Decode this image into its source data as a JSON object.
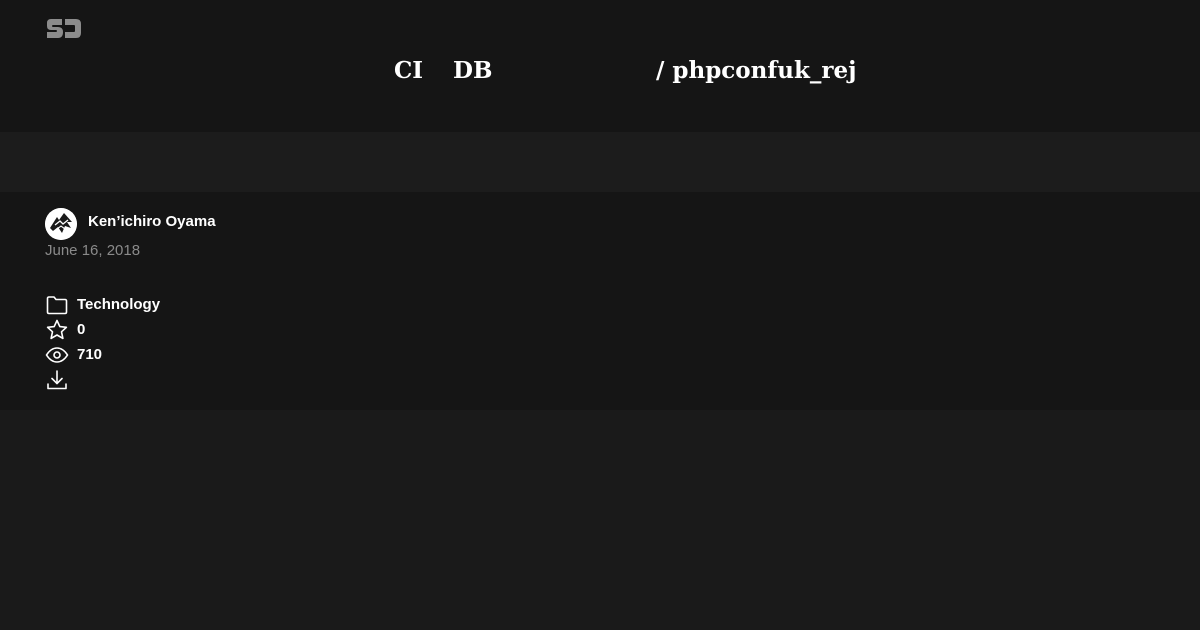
{
  "brand": {
    "logo_icon": "speakerdeck-logo-icon"
  },
  "deck": {
    "title_parts": [
      "CI",
      "DB",
      "/ phpconfuk_rej"
    ]
  },
  "author": {
    "name": "Ken’ichiro Oyama",
    "avatar_icon": "author-avatar"
  },
  "published": {
    "date": "June 16, 2018"
  },
  "stats": {
    "category": "Technology",
    "stars": "0",
    "views": "710"
  },
  "colors": {
    "header_bg": "#151515",
    "band_bg": "#1c1c1c",
    "page_bg": "#1a1a1a",
    "text": "#ffffff",
    "muted": "#8a8a8a",
    "logo": "#8c8c8c"
  }
}
